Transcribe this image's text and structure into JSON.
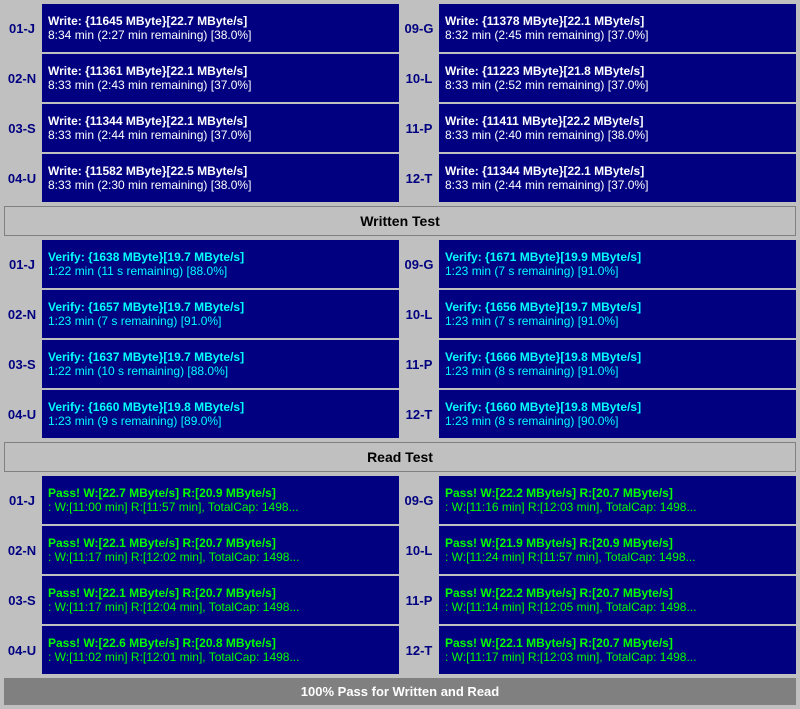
{
  "written_section": {
    "rows_left": [
      {
        "id": "01-J",
        "line1": "Write: {11645 MByte}[22.7 MByte/s]",
        "line2": "8:34 min (2:27 min remaining)  [38.0%]"
      },
      {
        "id": "02-N",
        "line1": "Write: {11361 MByte}[22.1 MByte/s]",
        "line2": "8:33 min (2:43 min remaining)  [37.0%]"
      },
      {
        "id": "03-S",
        "line1": "Write: {11344 MByte}[22.1 MByte/s]",
        "line2": "8:33 min (2:44 min remaining)  [37.0%]"
      },
      {
        "id": "04-U",
        "line1": "Write: {11582 MByte}[22.5 MByte/s]",
        "line2": "8:33 min (2:30 min remaining)  [38.0%]"
      }
    ],
    "rows_right": [
      {
        "id": "09-G",
        "line1": "Write: {11378 MByte}[22.1 MByte/s]",
        "line2": "8:32 min (2:45 min remaining)  [37.0%]"
      },
      {
        "id": "10-L",
        "line1": "Write: {11223 MByte}[21.8 MByte/s]",
        "line2": "8:33 min (2:52 min remaining)  [37.0%]"
      },
      {
        "id": "11-P",
        "line1": "Write: {11411 MByte}[22.2 MByte/s]",
        "line2": "8:33 min (2:40 min remaining)  [38.0%]"
      },
      {
        "id": "12-T",
        "line1": "Write: {11344 MByte}[22.1 MByte/s]",
        "line2": "8:33 min (2:44 min remaining)  [37.0%]"
      }
    ],
    "header": "Written Test"
  },
  "verify_section": {
    "rows_left": [
      {
        "id": "01-J",
        "line1": "Verify: {1638 MByte}[19.7 MByte/s]",
        "line2": "1:22 min (11 s remaining)  [88.0%]"
      },
      {
        "id": "02-N",
        "line1": "Verify: {1657 MByte}[19.7 MByte/s]",
        "line2": "1:23 min (7 s remaining)  [91.0%]"
      },
      {
        "id": "03-S",
        "line1": "Verify: {1637 MByte}[19.7 MByte/s]",
        "line2": "1:22 min (10 s remaining)  [88.0%]"
      },
      {
        "id": "04-U",
        "line1": "Verify: {1660 MByte}[19.8 MByte/s]",
        "line2": "1:23 min (9 s remaining)  [89.0%]"
      }
    ],
    "rows_right": [
      {
        "id": "09-G",
        "line1": "Verify: {1671 MByte}[19.9 MByte/s]",
        "line2": "1:23 min (7 s remaining)  [91.0%]"
      },
      {
        "id": "10-L",
        "line1": "Verify: {1656 MByte}[19.7 MByte/s]",
        "line2": "1:23 min (7 s remaining)  [91.0%]"
      },
      {
        "id": "11-P",
        "line1": "Verify: {1666 MByte}[19.8 MByte/s]",
        "line2": "1:23 min (8 s remaining)  [91.0%]"
      },
      {
        "id": "12-T",
        "line1": "Verify: {1660 MByte}[19.8 MByte/s]",
        "line2": "1:23 min (8 s remaining)  [90.0%]"
      }
    ]
  },
  "read_section": {
    "header": "Read Test",
    "rows_left": [
      {
        "id": "01-J",
        "line1": "Pass! W:[22.7 MByte/s] R:[20.9 MByte/s]",
        "line2": ": W:[11:00 min] R:[11:57 min], TotalCap: 1498..."
      },
      {
        "id": "02-N",
        "line1": "Pass! W:[22.1 MByte/s] R:[20.7 MByte/s]",
        "line2": ": W:[11:17 min] R:[12:02 min], TotalCap: 1498..."
      },
      {
        "id": "03-S",
        "line1": "Pass! W:[22.1 MByte/s] R:[20.7 MByte/s]",
        "line2": ": W:[11:17 min] R:[12:04 min], TotalCap: 1498..."
      },
      {
        "id": "04-U",
        "line1": "Pass! W:[22.6 MByte/s] R:[20.8 MByte/s]",
        "line2": ": W:[11:02 min] R:[12:01 min], TotalCap: 1498..."
      }
    ],
    "rows_right": [
      {
        "id": "09-G",
        "line1": "Pass! W:[22.2 MByte/s] R:[20.7 MByte/s]",
        "line2": ": W:[11:16 min] R:[12:03 min], TotalCap: 1498..."
      },
      {
        "id": "10-L",
        "line1": "Pass! W:[21.9 MByte/s] R:[20.9 MByte/s]",
        "line2": ": W:[11:24 min] R:[11:57 min], TotalCap: 1498..."
      },
      {
        "id": "11-P",
        "line1": "Pass! W:[22.2 MByte/s] R:[20.7 MByte/s]",
        "line2": ": W:[11:14 min] R:[12:05 min], TotalCap: 1498..."
      },
      {
        "id": "12-T",
        "line1": "Pass! W:[22.1 MByte/s] R:[20.7 MByte/s]",
        "line2": ": W:[11:17 min] R:[12:03 min], TotalCap: 1498..."
      }
    ]
  },
  "footer": {
    "text": "100% Pass for Written and Read"
  }
}
